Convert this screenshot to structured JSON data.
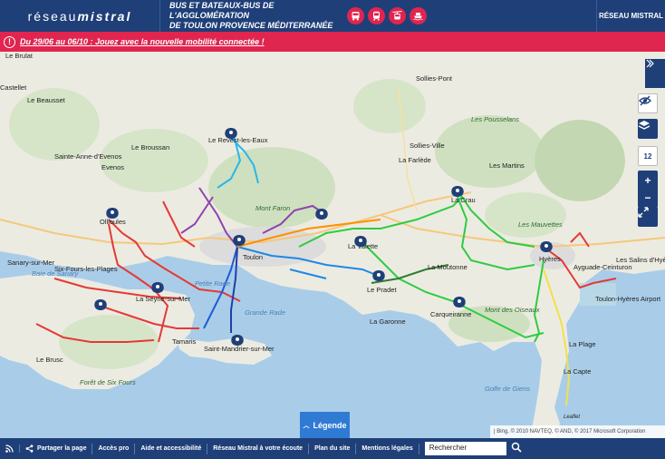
{
  "header": {
    "logo_light": "réseau",
    "logo_bold": "mistral",
    "tagline_line1": "BUS ET BATEAUX-BUS DE L'AGGLOMÉRATION",
    "tagline_line2": "DE TOULON PROVENCE MÉDITERRANÉE",
    "mode_icons": [
      "bus-icon",
      "bus-front-icon",
      "cable-car-icon",
      "boat-icon"
    ],
    "brand_right": "RÉSEAU MISTRAL"
  },
  "alert": {
    "icon": "alert-icon",
    "text": "Du 29/06 au 06/10 : Jouez avec la nouvelle mobilité connectée !"
  },
  "map": {
    "controls": {
      "side_tab": "chevron-right-icon",
      "visibility": "eye-slash-icon",
      "layers": "layers-icon",
      "zoom_level": "12",
      "zoom_in": "+",
      "zoom_out": "−",
      "fullscreen": "fullscreen-icon"
    },
    "legend_button": "Légende",
    "attribution": "| Bing, © 2010 NAVTEQ, © AND, © 2017 Microsoft Corporation",
    "attribution_leaflet": "Leaflet",
    "places": [
      {
        "name": "Le Brulat",
        "cls": ""
      },
      {
        "name": "Castellet",
        "cls": ""
      },
      {
        "name": "Le Beausset",
        "cls": ""
      },
      {
        "name": "Sollies-Pont",
        "cls": ""
      },
      {
        "name": "Les Pousselans",
        "cls": "relief"
      },
      {
        "name": "Le Revest-les-Eaux",
        "cls": ""
      },
      {
        "name": "Le Broussan",
        "cls": ""
      },
      {
        "name": "Sainte-Anne-d'Evenos",
        "cls": ""
      },
      {
        "name": "Evenos",
        "cls": ""
      },
      {
        "name": "Sollies-Ville",
        "cls": ""
      },
      {
        "name": "La Farlède",
        "cls": ""
      },
      {
        "name": "Les Martins",
        "cls": ""
      },
      {
        "name": "Mont Faron",
        "cls": "relief"
      },
      {
        "name": "La Crau",
        "cls": ""
      },
      {
        "name": "Ollioules",
        "cls": ""
      },
      {
        "name": "Les Mauvettes",
        "cls": "relief"
      },
      {
        "name": "La Valette",
        "cls": ""
      },
      {
        "name": "Sanary-sur-Mer",
        "cls": ""
      },
      {
        "name": "Six-Fours-les-Plages",
        "cls": ""
      },
      {
        "name": "Baie de Sanary",
        "cls": "sea"
      },
      {
        "name": "La Moutonne",
        "cls": ""
      },
      {
        "name": "Hyères",
        "cls": ""
      },
      {
        "name": "Ayguade-Ceinturon",
        "cls": ""
      },
      {
        "name": "Les Salins d'Hyères",
        "cls": ""
      },
      {
        "name": "Petite Rade",
        "cls": "sea"
      },
      {
        "name": "La Seyne-sur-Mer",
        "cls": ""
      },
      {
        "name": "Le Pradet",
        "cls": ""
      },
      {
        "name": "Carqueiranne",
        "cls": ""
      },
      {
        "name": "Mont des Oiseaux",
        "cls": "relief"
      },
      {
        "name": "Toulon-Hyères Airport",
        "cls": ""
      },
      {
        "name": "Grande Rade",
        "cls": "sea"
      },
      {
        "name": "La Garonne",
        "cls": ""
      },
      {
        "name": "La Plage",
        "cls": ""
      },
      {
        "name": "Saint-Mandrier-sur-Mer",
        "cls": ""
      },
      {
        "name": "Tamaris",
        "cls": ""
      },
      {
        "name": "Le Brusc",
        "cls": ""
      },
      {
        "name": "La Capte",
        "cls": ""
      },
      {
        "name": "Forêt de Six Fours",
        "cls": "relief"
      },
      {
        "name": "Golfe de Giens",
        "cls": "sea"
      },
      {
        "name": "Toulon",
        "cls": ""
      }
    ]
  },
  "footer": {
    "rss_icon": "rss-icon",
    "share_icon": "share-icon",
    "links": [
      "Partager la page",
      "Accès pro",
      "Aide et accessibilité",
      "Réseau Mistral à votre écoute",
      "Plan du site",
      "Mentions légales"
    ],
    "search_value": "Rechercher",
    "search_icon": "search-icon"
  }
}
